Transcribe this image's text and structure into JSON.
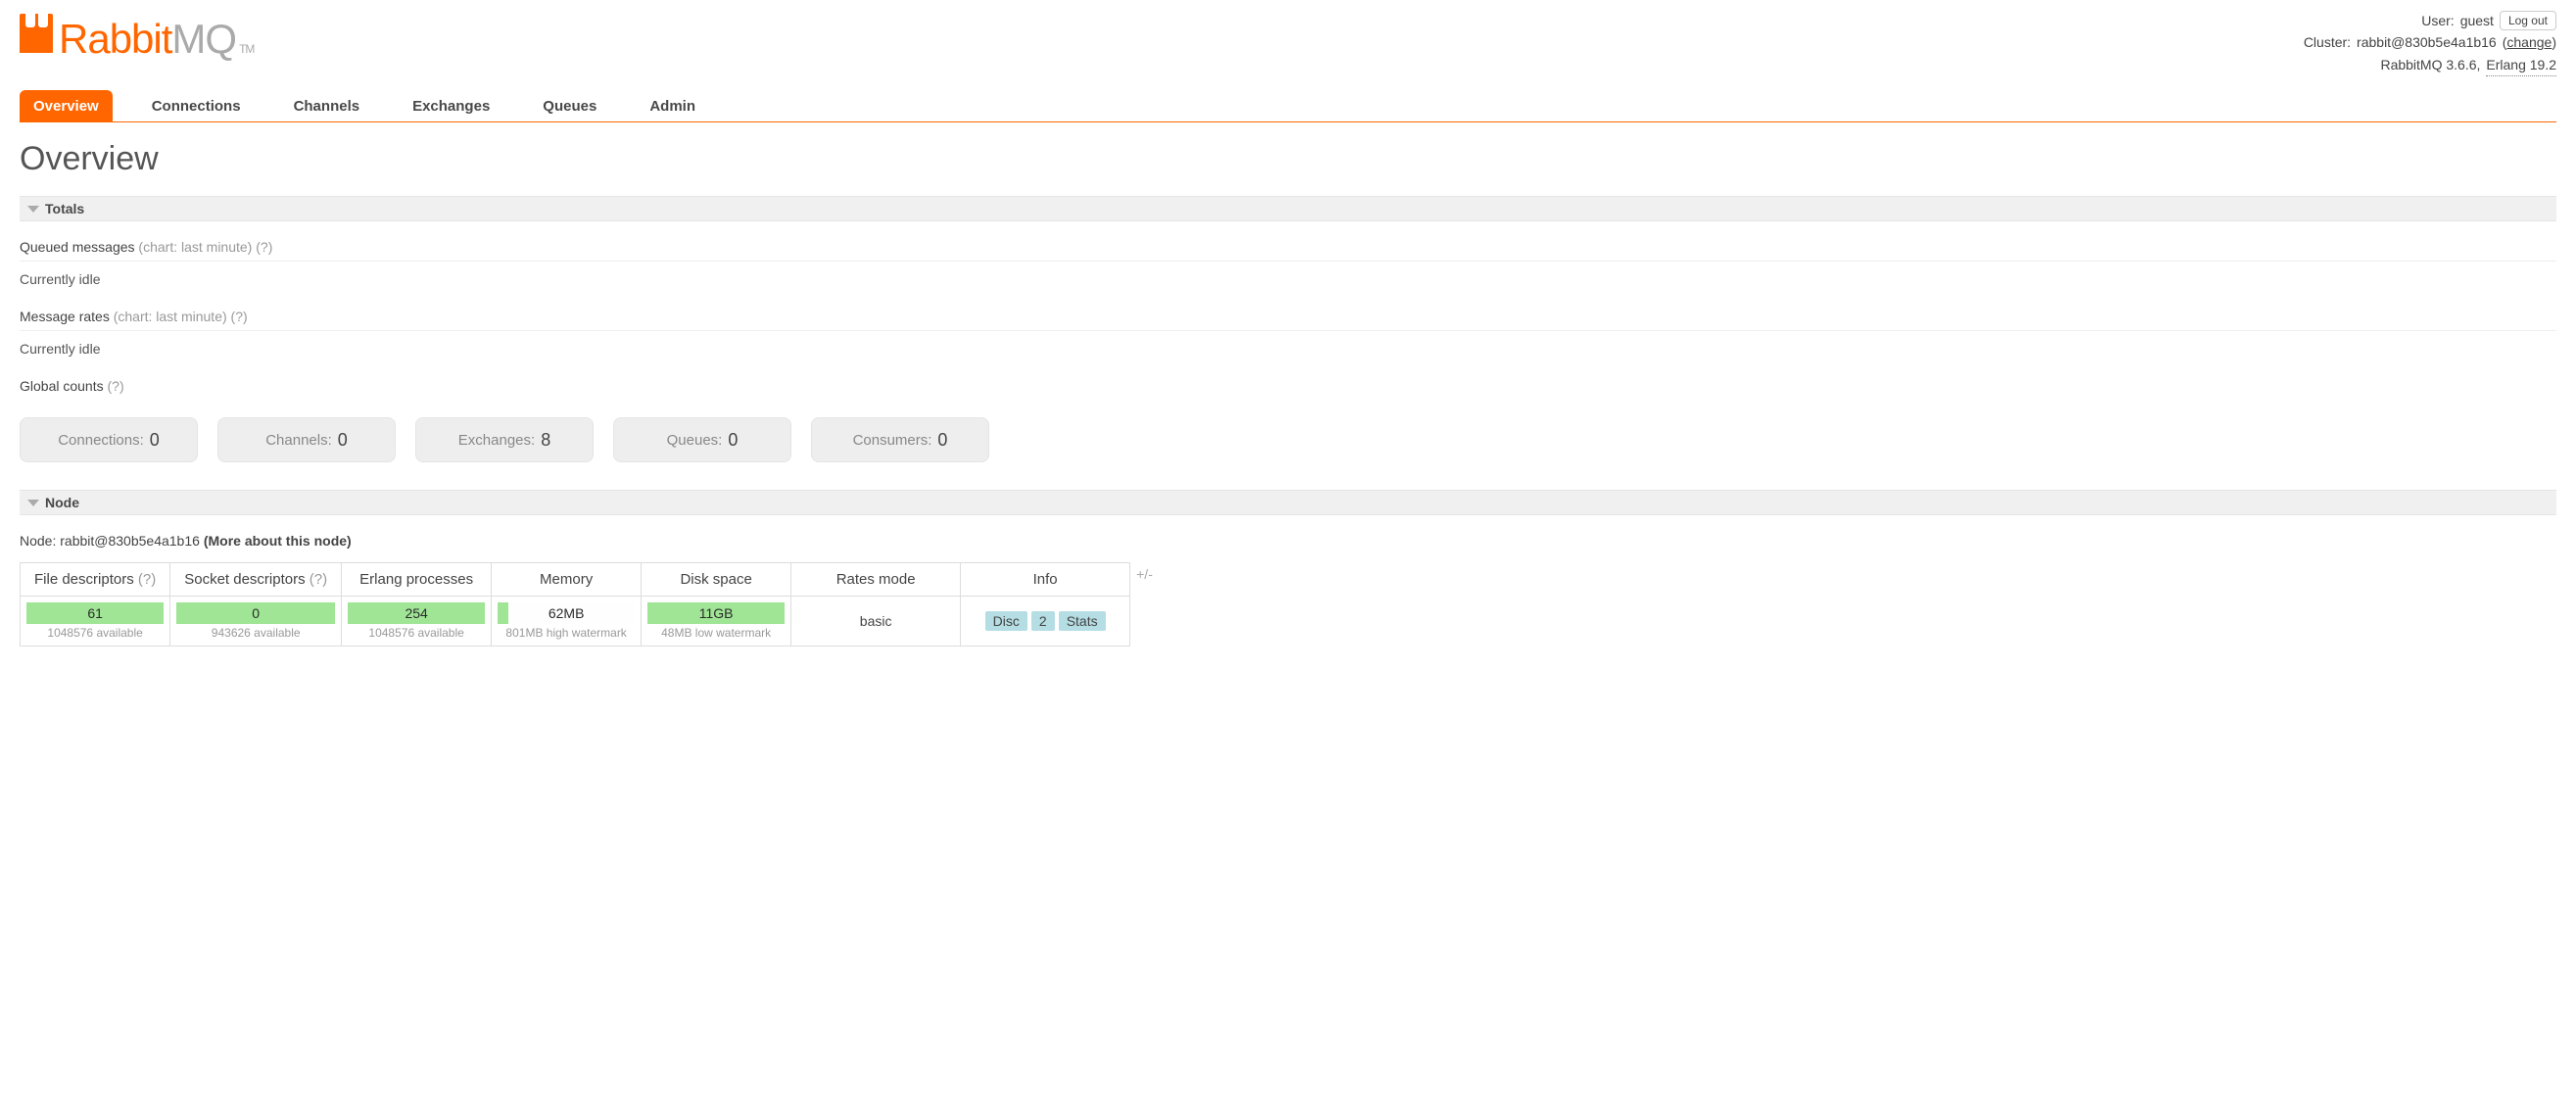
{
  "header": {
    "user_label": "User:",
    "user_value": "guest",
    "logout": "Log out",
    "cluster_label": "Cluster:",
    "cluster_value": "rabbit@830b5e4a1b16",
    "change": "change",
    "product": "RabbitMQ 3.6.6,",
    "erlang": "Erlang 19.2"
  },
  "logo": {
    "name": "Rabbit",
    "suffix": "MQ",
    "tm": "TM"
  },
  "tabs": [
    "Overview",
    "Connections",
    "Channels",
    "Exchanges",
    "Queues",
    "Admin"
  ],
  "active_tab": 0,
  "page_title": "Overview",
  "sections": {
    "totals": "Totals",
    "node": "Node"
  },
  "totals": {
    "queued_label": "Queued messages",
    "queued_note": "(chart: last minute)",
    "queued_help": "(?)",
    "queued_status": "Currently idle",
    "rates_label": "Message rates",
    "rates_note": "(chart: last minute)",
    "rates_help": "(?)",
    "rates_status": "Currently idle",
    "global_label": "Global counts",
    "global_help": "(?)"
  },
  "counts": [
    {
      "label": "Connections:",
      "value": "0"
    },
    {
      "label": "Channels:",
      "value": "0"
    },
    {
      "label": "Exchanges:",
      "value": "8"
    },
    {
      "label": "Queues:",
      "value": "0"
    },
    {
      "label": "Consumers:",
      "value": "0"
    }
  ],
  "node": {
    "line_prefix": "Node:",
    "line_value": "rabbit@830b5e4a1b16",
    "more": "(More about this node)",
    "plusminus": "+/-",
    "columns": [
      "File descriptors",
      "Socket descriptors",
      "Erlang processes",
      "Memory",
      "Disk space",
      "Rates mode",
      "Info"
    ],
    "help_cols": [
      true,
      true,
      false,
      false,
      false,
      false,
      false
    ],
    "cells": {
      "fd": {
        "value": "61",
        "sub": "1048576 available",
        "fill_pct": 100
      },
      "sock": {
        "value": "0",
        "sub": "943626 available",
        "fill_pct": 100
      },
      "proc": {
        "value": "254",
        "sub": "1048576 available",
        "fill_pct": 100
      },
      "mem": {
        "value": "62MB",
        "sub": "801MB high watermark",
        "fill_pct": 8
      },
      "disk": {
        "value": "11GB",
        "sub": "48MB low watermark",
        "fill_pct": 100
      },
      "rates": "basic",
      "info_badges": [
        "Disc",
        "2",
        "Stats"
      ]
    }
  }
}
